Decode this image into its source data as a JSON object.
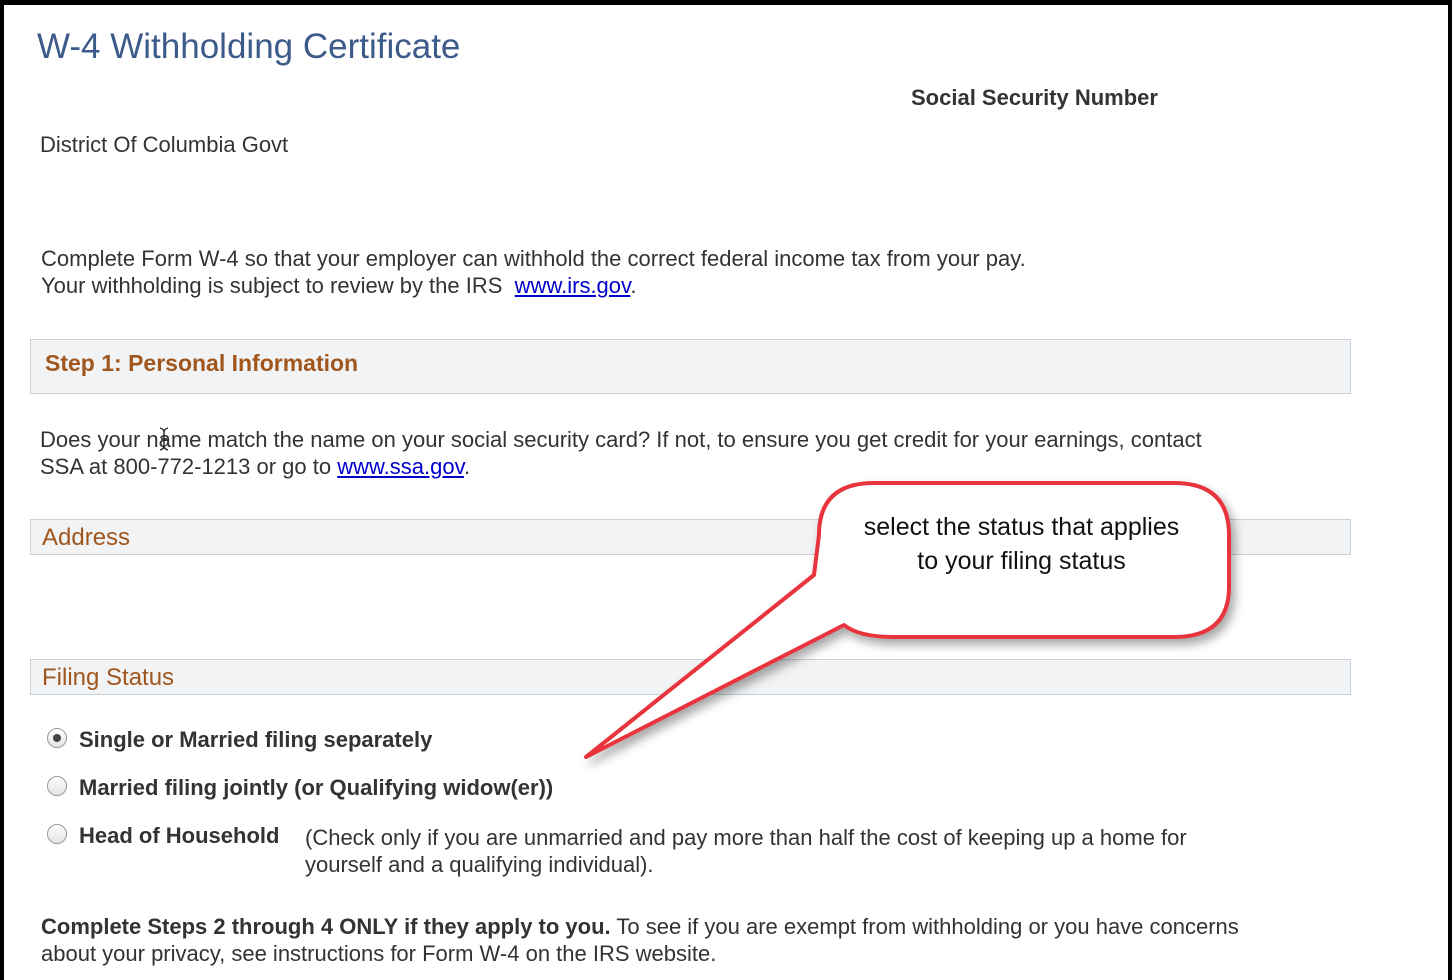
{
  "page": {
    "title": "W-4 Withholding Certificate",
    "ssn_label": "Social Security Number",
    "employer": "District Of Columbia Govt"
  },
  "intro": {
    "line1": "Complete Form W-4 so that your employer can withhold the correct federal income tax from your pay.",
    "line2_prefix": "Your withholding is subject to review by the IRS",
    "irs_link": "www.irs.gov",
    "line2_suffix": "."
  },
  "step1": {
    "title": "Step 1: Personal Information",
    "name_note_line1": "Does your name match the name on your social security card? If not, to ensure you get credit for your earnings, contact",
    "name_note_line2_prefix": "SSA at 800-772-1213 or go to",
    "ssa_link": "www.ssa.gov",
    "name_note_line2_suffix": "."
  },
  "address": {
    "title": "Address"
  },
  "filing_status": {
    "title": "Filing Status",
    "options": [
      {
        "label": "Single or Married filing separately",
        "selected": true
      },
      {
        "label": "Married filing jointly (or Qualifying widow(er))",
        "selected": false
      },
      {
        "label": "Head of Household",
        "selected": false
      }
    ],
    "hoh_desc_line1": "(Check only if you are unmarried and pay more than half the cost of keeping up a home for",
    "hoh_desc_line2": "yourself and a qualifying individual)."
  },
  "steps_note": {
    "bold": "Complete Steps 2 through 4 ONLY if they apply to you.",
    "rest_line1": "To see if you are exempt from withholding or you have concerns",
    "line2": "about your privacy, see instructions for Form W-4 on the IRS website."
  },
  "callout": {
    "text": "select the status that applies to your filing status",
    "border_color": "#e8343c"
  },
  "cursor": {
    "icon": "text-cursor-icon"
  }
}
